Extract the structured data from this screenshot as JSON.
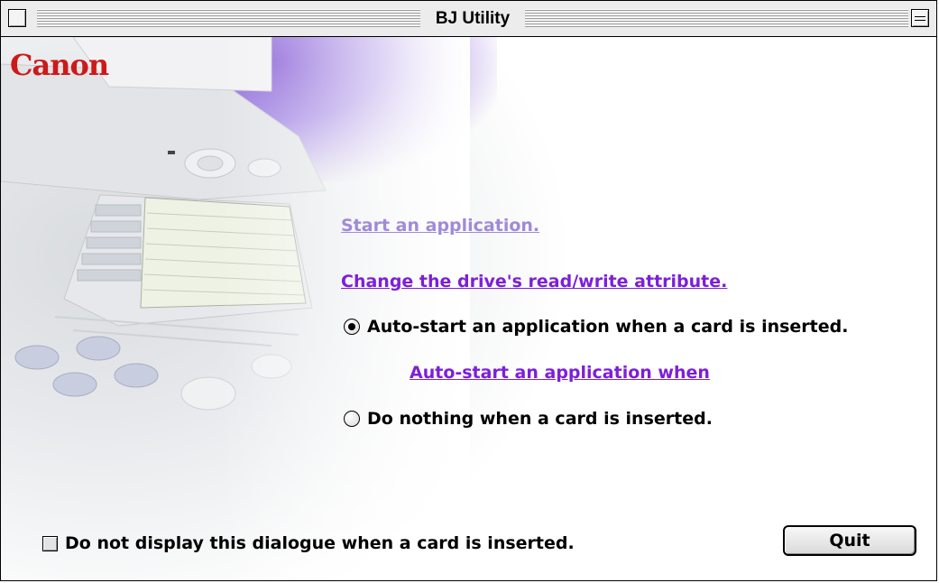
{
  "window": {
    "title": "BJ Utility"
  },
  "branding": {
    "logo_text": "Canon",
    "logo_color": "#cc1a1a"
  },
  "links": {
    "start_application": "Start an application.",
    "change_attribute": "Change the drive's read/write attribute.",
    "auto_start_when": "Auto-start an application when"
  },
  "options": {
    "auto_start_label": "Auto-start an application when a card is inserted.",
    "auto_start_selected": true,
    "do_nothing_label": "Do nothing when a card is inserted.",
    "do_nothing_selected": false
  },
  "footer": {
    "dont_display_label": "Do not display this dialogue when a card is inserted.",
    "dont_display_checked": false,
    "quit_label": "Quit"
  },
  "colors": {
    "link_visited": "#a08ad8",
    "link": "#7d1fd8"
  }
}
